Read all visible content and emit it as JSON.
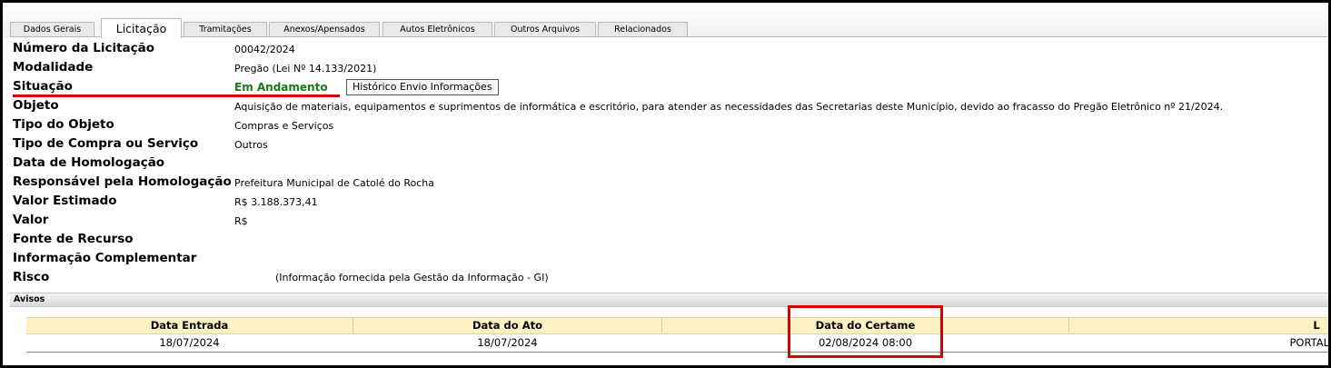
{
  "tabs": [
    {
      "label": "Dados Gerais",
      "active": false
    },
    {
      "label": "Licitação",
      "active": true
    },
    {
      "label": "Tramitações",
      "active": false
    },
    {
      "label": "Anexos/Apensados",
      "active": false
    },
    {
      "label": "Autos Eletrônicos",
      "active": false
    },
    {
      "label": "Outros Arquivos",
      "active": false
    },
    {
      "label": "Relacionados",
      "active": false
    }
  ],
  "fields": {
    "numero": {
      "label": "Número da Licitação",
      "value": "00042/2024"
    },
    "modalidade": {
      "label": "Modalidade",
      "value": "Pregão (Lei Nº 14.133/2021)"
    },
    "situacao": {
      "label": "Situação",
      "value": "Em Andamento",
      "button": "Histórico Envio Informações"
    },
    "objeto": {
      "label": "Objeto",
      "value": "Aquisição de materiais, equipamentos e suprimentos de informática e escritório, para atender as necessidades das Secretarias deste Município, devido ao fracasso do Pregão Eletrônico nº 21/2024."
    },
    "tipo_objeto": {
      "label": "Tipo do Objeto",
      "value": "Compras e Serviços"
    },
    "tipo_compra": {
      "label": "Tipo de Compra ou Serviço",
      "value": "Outros"
    },
    "data_homologacao": {
      "label": "Data de Homologação",
      "value": ""
    },
    "responsavel": {
      "label": "Responsável pela Homologação",
      "value": "Prefeitura Municipal de Catolé do Rocha"
    },
    "valor_estimado": {
      "label": "Valor Estimado",
      "value": "R$ 3.188.373,41"
    },
    "valor": {
      "label": "Valor",
      "value": "R$"
    },
    "fonte_recurso": {
      "label": "Fonte de Recurso",
      "value": ""
    },
    "info_complementar": {
      "label": "Informação Complementar",
      "value": ""
    },
    "risco": {
      "label": "Risco",
      "value": "(Informação fornecida pela Gestão da Informação - GI)"
    }
  },
  "avisos": {
    "title": "Avisos",
    "columns": [
      "Data Entrada",
      "Data do Ato",
      "Data do Certame",
      "L"
    ],
    "rows": [
      [
        "18/07/2024",
        "18/07/2024",
        "02/08/2024 08:00",
        "PORTAL"
      ]
    ]
  },
  "colors": {
    "highlight": "#d40000",
    "status": "#157a15",
    "header_bg": "#fdf3c2"
  }
}
